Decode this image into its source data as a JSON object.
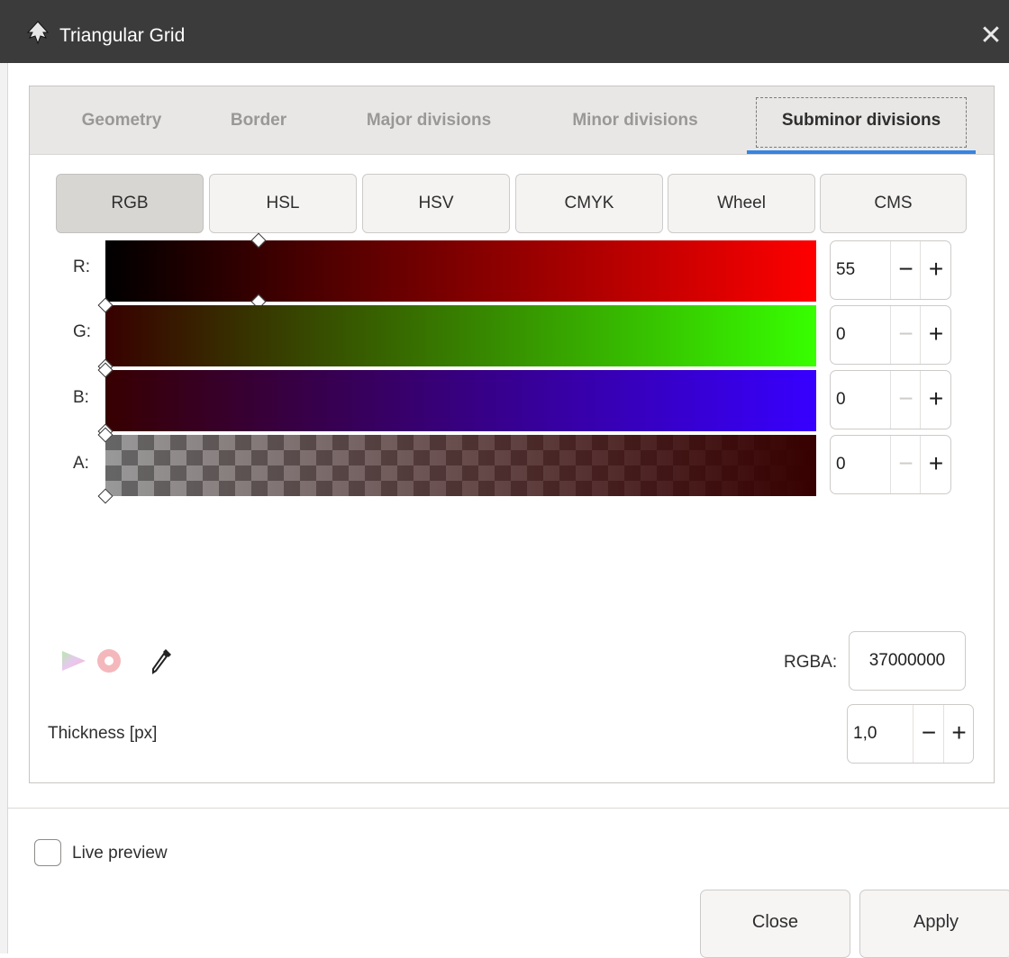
{
  "window": {
    "title": "Triangular Grid",
    "close_symbol": "✕"
  },
  "tabs": [
    {
      "label": "Geometry",
      "active": false
    },
    {
      "label": "Border",
      "active": false
    },
    {
      "label": "Major divisions",
      "active": false
    },
    {
      "label": "Minor divisions",
      "active": false
    },
    {
      "label": "Subminor divisions",
      "active": true
    }
  ],
  "color_modes": [
    {
      "label": "RGB",
      "active": true
    },
    {
      "label": "HSL",
      "active": false
    },
    {
      "label": "HSV",
      "active": false
    },
    {
      "label": "CMYK",
      "active": false
    },
    {
      "label": "Wheel",
      "active": false
    },
    {
      "label": "CMS",
      "active": false
    }
  ],
  "channels": [
    {
      "label": "R:",
      "value": "55",
      "fraction": 0.216,
      "minus_enabled": true
    },
    {
      "label": "G:",
      "value": "0",
      "fraction": 0,
      "minus_enabled": false
    },
    {
      "label": "B:",
      "value": "0",
      "fraction": 0,
      "minus_enabled": false
    },
    {
      "label": "A:",
      "value": "0",
      "fraction": 0,
      "minus_enabled": false
    }
  ],
  "spin_symbols": {
    "minus": "−",
    "plus": "+"
  },
  "tools": {
    "gamut_icon": "gamut-triangle-icon",
    "out_of_gamut_icon": "out-of-gamut-icon",
    "picker_icon": "eyedropper-icon"
  },
  "rgba": {
    "label": "RGBA:",
    "value": "37000000"
  },
  "thickness": {
    "label": "Thickness [px]",
    "value": "1,0"
  },
  "live_preview": {
    "label": "Live preview",
    "checked": false
  },
  "buttons": {
    "close": "Close",
    "apply": "Apply"
  },
  "colors": {
    "accent": "#3584e4",
    "titlebar": "#3b3b3b",
    "current_color": "#370000"
  }
}
